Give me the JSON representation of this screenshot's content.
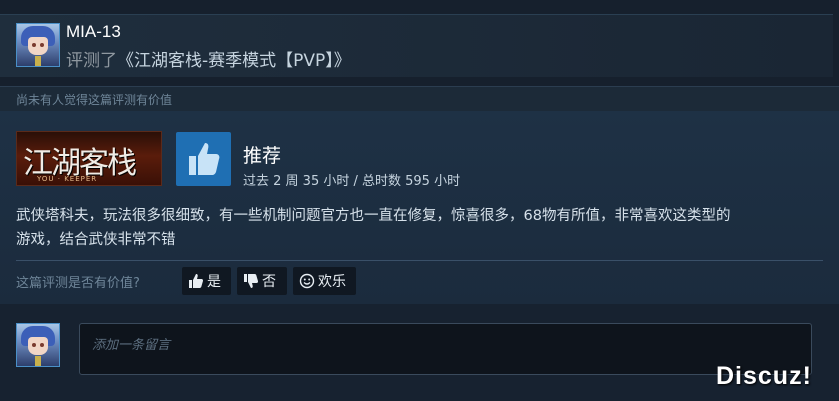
{
  "review": {
    "author": "MIA-13",
    "reviewed_prefix": "评测了",
    "game_title": "《江湖客栈-赛季模式【PVP】》",
    "helpful_status": "尚未有人觉得这篇评测有价值",
    "game_capsule": {
      "title_text": "江湖客栈",
      "subtitle_text": "YOU · KEEPER"
    },
    "verdict": "推荐",
    "hours": "过去 2 周 35 小时 / 总时数 595 小时",
    "body_line1": "武侠塔科夫，玩法很多很细致，有一些机制问题官方也一直在修复，惊喜很多，68物有所值，非常喜欢这类型的",
    "body_line2": "游戏，结合武侠非常不错"
  },
  "vote": {
    "question": "这篇评测是否有价值?",
    "yes_label": "是",
    "no_label": "否",
    "funny_label": "欢乐"
  },
  "comment": {
    "placeholder": "添加一条留言"
  },
  "watermark": "Discuz!",
  "colors": {
    "accent": "#1f6fb3",
    "background": "#1b2838"
  },
  "icons": [
    "thumbs-up-icon",
    "thumbs-down-icon",
    "smiley-icon"
  ]
}
